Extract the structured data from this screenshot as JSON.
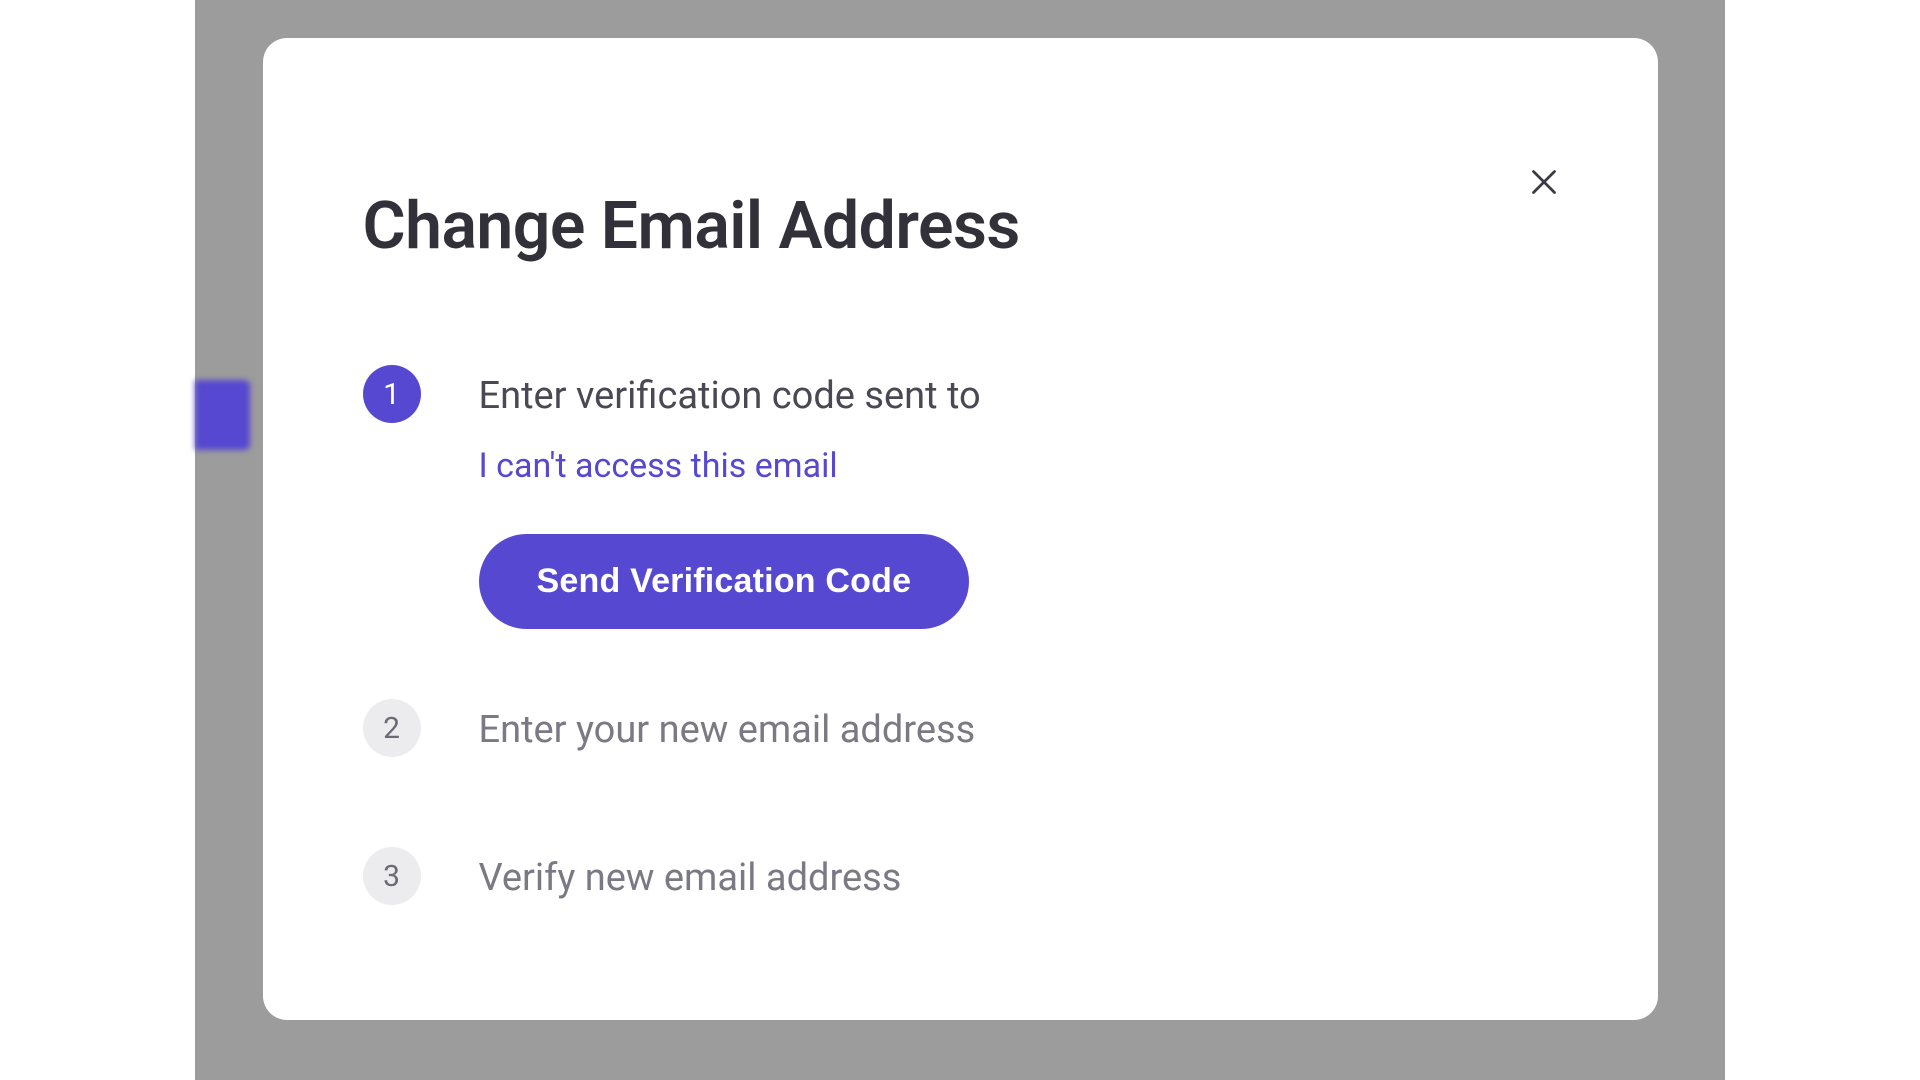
{
  "modal": {
    "title": "Change Email Address",
    "steps": [
      {
        "number": "1",
        "title": "Enter verification code sent to",
        "link": "I can't access this email",
        "button": "Send Verification Code"
      },
      {
        "number": "2",
        "title": "Enter your new email address"
      },
      {
        "number": "3",
        "title": "Verify new email address"
      }
    ]
  }
}
